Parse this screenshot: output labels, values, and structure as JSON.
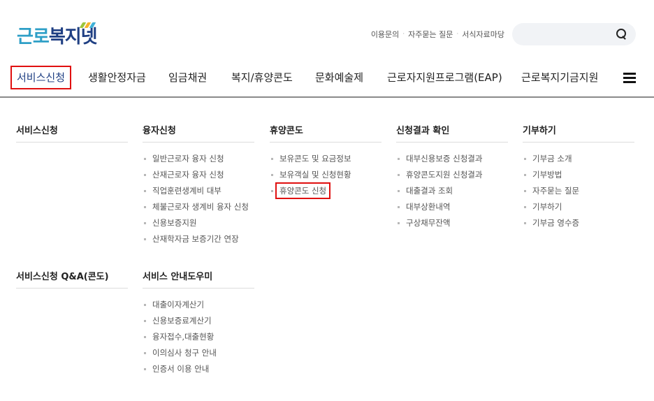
{
  "logo": {
    "part1": "근로",
    "part2": "복지넷",
    "leaf_colors": [
      "#9cc63c",
      "#f7b32b",
      "#3fb0d6"
    ]
  },
  "utility": [
    "이용문의",
    "자주묻는 질문",
    "서식자료마당"
  ],
  "search": {
    "placeholder": "",
    "icon": "search-icon"
  },
  "gnb": [
    {
      "label": "서비스신청",
      "active": true
    },
    {
      "label": "생활안정자금",
      "active": false
    },
    {
      "label": "임금채권",
      "active": false
    },
    {
      "label": "복지/휴양콘도",
      "active": false
    },
    {
      "label": "문화예술제",
      "active": false
    },
    {
      "label": "근로자지원프로그램(EAP)",
      "active": false
    },
    {
      "label": "근로복지기금지원",
      "active": false
    }
  ],
  "menu_icon": "hamburger-menu-icon",
  "columns": [
    {
      "title": "서비스신청",
      "items": []
    },
    {
      "title": "융자신청",
      "items": [
        "일반근로자 융자 신청",
        "산재근로자 융자 신청",
        "직업훈련생계비 대부",
        "체불근로자 생계비 융자 신청",
        "신용보증지원",
        "산재학자금 보증기간 연장"
      ]
    },
    {
      "title": "휴양콘도",
      "items": [
        "보유콘도 및 요금정보",
        "보유객실 및 신청현황",
        "휴양콘도 신청"
      ]
    },
    {
      "title": "신청결과 확인",
      "items": [
        "대부신용보증 신청결과",
        "휴양콘도지원 신청결과",
        "대출결과 조회",
        "대부상환내역",
        "구상채무잔액"
      ]
    },
    {
      "title": "기부하기",
      "items": [
        "기부금 소개",
        "기부방법",
        "자주묻는 질문",
        "기부하기",
        "기부금 영수증"
      ]
    },
    {
      "title": "서비스신청 Q&A(콘도)",
      "items": []
    },
    {
      "title": "서비스 안내도우미",
      "items": [
        "대출이자계산기",
        "신용보증료계산기",
        "융자접수,대출현황",
        "이의심사 청구 안내",
        "인증서 이용 안내"
      ]
    }
  ],
  "accent_color": "#e01010",
  "brand_color": "#1f3f83"
}
